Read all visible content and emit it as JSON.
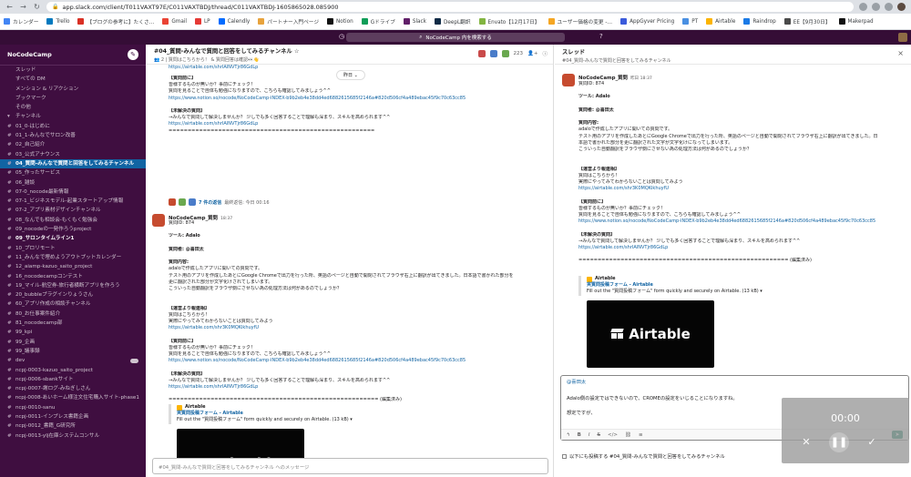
{
  "browser": {
    "url": "app.slack.com/client/T011VAXT97E/C011VAXTBDJ/thread/C011VAXTBDJ-1605865028.085900",
    "bookmarks": [
      {
        "label": "カレンダー",
        "color": "#4285f4"
      },
      {
        "label": "Trello",
        "color": "#0079bf"
      },
      {
        "label": "【ブログの参考に】たくさ…",
        "color": "#d93025"
      },
      {
        "label": "Gmail",
        "color": "#ea4335"
      },
      {
        "label": "LP",
        "color": "#e53935"
      },
      {
        "label": "Calendly",
        "color": "#006bff"
      },
      {
        "label": "パートナー入門ページ",
        "color": "#e8a33d"
      },
      {
        "label": "Notion",
        "color": "#111111"
      },
      {
        "label": "Gドライブ",
        "color": "#0f9d58"
      },
      {
        "label": "Slack",
        "color": "#611f69"
      },
      {
        "label": "DeepL翻訳",
        "color": "#0f2b46"
      },
      {
        "label": "Envato【12月17日】",
        "color": "#82b541"
      },
      {
        "label": "ユーザー価格の変更 -…",
        "color": "#f5a623"
      },
      {
        "label": "AppGyver Pricing",
        "color": "#3b5bdb"
      },
      {
        "label": "PT",
        "color": "#4a90e2"
      },
      {
        "label": "Airtable",
        "color": "#fcb400"
      },
      {
        "label": "Raindrop",
        "color": "#1a7ae6"
      },
      {
        "label": "EE【9月30日】",
        "color": "#4a4a4a"
      },
      {
        "label": "Makerpad",
        "color": "#111111"
      }
    ]
  },
  "slack_top": {
    "search_text": "NoCodeCamp 内を検索する"
  },
  "sidebar": {
    "workspace": "NoCodeCamp",
    "items": [
      {
        "label": "スレッド",
        "icon": "",
        "style": ""
      },
      {
        "label": "すべての DM",
        "icon": "",
        "style": ""
      },
      {
        "label": "メンション & リアクション",
        "icon": "",
        "style": ""
      },
      {
        "label": "ブックマーク",
        "icon": "",
        "style": ""
      },
      {
        "label": "その他",
        "icon": "",
        "style": ""
      },
      {
        "label": "チャンネル",
        "icon": "▾",
        "style": ""
      },
      {
        "label": "01_0-はじめに",
        "icon": "#",
        "style": ""
      },
      {
        "label": "01_1-みんなでサロン改善",
        "icon": "#",
        "style": ""
      },
      {
        "label": "02_自己紹介",
        "icon": "#",
        "style": ""
      },
      {
        "label": "03_公式アナウンス",
        "icon": "#",
        "style": ""
      },
      {
        "label": "04_質問-みんなで質問と回答をしてみるチャンネル",
        "icon": "#",
        "style": "active"
      },
      {
        "label": "05_作ったサービス",
        "icon": "#",
        "style": ""
      },
      {
        "label": "06_雑談",
        "icon": "#",
        "style": ""
      },
      {
        "label": "07-0_nocode最新情報",
        "icon": "#",
        "style": ""
      },
      {
        "label": "07-1_ビジネスモデル-起業スタートアップ情報",
        "icon": "#",
        "style": ""
      },
      {
        "label": "07-2_アプリ素材デザインチャンネル",
        "icon": "#",
        "style": ""
      },
      {
        "label": "08_なんでも相談会-もくもく勉強会",
        "icon": "#",
        "style": ""
      },
      {
        "label": "09_nocodeの一発作ろうproject",
        "icon": "#",
        "style": ""
      },
      {
        "label": "09_サロンタイムライン1",
        "icon": "#",
        "style": "bold"
      },
      {
        "label": "10_プロリモート",
        "icon": "#",
        "style": ""
      },
      {
        "label": "11_みんなで埋めようアウトプットカレンダー",
        "icon": "#",
        "style": ""
      },
      {
        "label": "12_aiamp-kazuo_saito_project",
        "icon": "#",
        "style": ""
      },
      {
        "label": "16_nocodecampコンテスト",
        "icon": "#",
        "style": ""
      },
      {
        "label": "19_マイル-航空券-旅行者横断アプリを作ろう",
        "icon": "#",
        "style": ""
      },
      {
        "label": "20_bubbleプラグインりょうさん",
        "icon": "#",
        "style": ""
      },
      {
        "label": "60_アプリ作成の相談チャンネル",
        "icon": "#",
        "style": ""
      },
      {
        "label": "80_お仕事案件紹介",
        "icon": "#",
        "style": ""
      },
      {
        "label": "81_nocodecamp部",
        "icon": "#",
        "style": ""
      },
      {
        "label": "99_kpi",
        "icon": "#",
        "style": ""
      },
      {
        "label": "99_企画",
        "icon": "#",
        "style": ""
      },
      {
        "label": "99_議事録",
        "icon": "#",
        "style": ""
      },
      {
        "label": "dev",
        "icon": "#",
        "style": "toggle"
      },
      {
        "label": "ncpj-0003-kazuo_saito_project",
        "icon": "#",
        "style": ""
      },
      {
        "label": "ncpj-0006-sbankサイト",
        "icon": "#",
        "style": ""
      },
      {
        "label": "ncpj-0007-謝ログ-みねぎしさん",
        "icon": "#",
        "style": ""
      },
      {
        "label": "ncpj-0008-あいホーム様注文住宅購入サイト-phase1",
        "icon": "#",
        "style": ""
      },
      {
        "label": "ncpj-0010-sanu",
        "icon": "#",
        "style": ""
      },
      {
        "label": "ncpj-0011-インプレス書籍企画",
        "icon": "#",
        "style": ""
      },
      {
        "label": "ncpj-0012_書籍_G研究所",
        "icon": "#",
        "style": ""
      },
      {
        "label": "ncpj-0013-ylj在庫システムコンサル",
        "icon": "#",
        "style": ""
      }
    ]
  },
  "channel": {
    "title": "#04_質問-みんなで質問と回答をしてみるチャンネル ☆",
    "topic": "👥 2  |  質問はこちらから！ & 質問回答は確認👀👋",
    "member_count": "223",
    "day_label": "昨日 ⌄",
    "old_link": "https://airtable.com/shrIAINVTjr86GdLp",
    "q_block": [
      {
        "t": "【質問前に】",
        "c": "bold"
      },
      {
        "t": "皆様するものが無いか？事前にチェック！",
        "c": ""
      },
      {
        "t": "質問を見ることで自体も勉強になりますので、こちらも確認してみましょう^^",
        "c": ""
      },
      {
        "t": "https://www.notion.so/nocode/NoCodeCamp-INDEX-b9b2eb4e38dd4ed6882615685f2146a#820d506cf4a489ebac45f9c70c63cc85",
        "c": "lnk"
      },
      {
        "t": "",
        "c": ""
      },
      {
        "t": "【未解決の質問】",
        "c": "bold"
      },
      {
        "t": "→みんなで質問して解決しませんか？ 少しでも多く回答することで理解も深まり、スキルを高められます^^",
        "c": ""
      },
      {
        "t": "https://airtable.com/shrIAINVTjr86GdLp",
        "c": "lnk"
      },
      {
        "t": "======================================================",
        "c": ""
      }
    ],
    "reactions": {
      "count_text": "7 件の返信",
      "last_text": "最終返信: 今日 00:16"
    },
    "msg2": {
      "name": "NoCodeCamp_質問",
      "time": "18:37",
      "lines": [
        {
          "t": "質問ID: 874",
          "c": ""
        },
        {
          "t": "",
          "c": ""
        },
        {
          "t": "ツール: Adalo",
          "c": "bold"
        },
        {
          "t": "",
          "c": ""
        },
        {
          "t": "質問者: @喜田太",
          "c": "bold"
        },
        {
          "t": "",
          "c": ""
        },
        {
          "t": "質問内容:",
          "c": "bold"
        },
        {
          "t": "adaloで作成したアプリに開いての質問です。",
          "c": ""
        },
        {
          "t": "テスト用のアプリを作成したあとにGoogle Chromeで出力を行った所、英語のページと自動で開閉されてブラウザ右上に翻訳が出てきました。日本語で書かれた部分を",
          "c": ""
        },
        {
          "t": "更に翻訳された部分が文字化けされてしまいます。",
          "c": ""
        },
        {
          "t": "こういった自動翻訳をブラウザ側にさせない為の処理方法は何があるのでしょうか？",
          "c": ""
        },
        {
          "t": "",
          "c": ""
        },
        {
          "t": "",
          "c": ""
        },
        {
          "t": "【運営より報連相】",
          "c": "bold"
        },
        {
          "t": "質問はこちらから！",
          "c": ""
        },
        {
          "t": "実際にやってみてわからないことは質問してみよう",
          "c": ""
        },
        {
          "t": "https://airtable.com/shr3K0MQKikhuyfU",
          "c": "lnk"
        },
        {
          "t": "",
          "c": ""
        },
        {
          "t": "【質問前に】",
          "c": "bold"
        },
        {
          "t": "皆様するものが無いか？事前にチェック！",
          "c": ""
        },
        {
          "t": "質問を見ることで自体も勉強になりますので、こちらも確認してみましょう^^",
          "c": ""
        },
        {
          "t": "https://www.notion.so/nocode/NoCodeCamp-INDEX-b9b2eb4e38dd4ed6882615685f2146a#820d506cf4a489ebac45f9c70c63cc85",
          "c": "lnk"
        },
        {
          "t": "",
          "c": ""
        },
        {
          "t": "【未解決の質問】",
          "c": "bold"
        },
        {
          "t": "→みんなで質問して解決しませんか？ 少しでも多く回答することで理解も深まり、スキルを高められます^^",
          "c": ""
        },
        {
          "t": "https://airtable.com/shrIAINVTjr86GdLp",
          "c": "lnk"
        },
        {
          "t": "",
          "c": ""
        },
        {
          "t": "======================================================= (編集済み)",
          "c": ""
        }
      ]
    },
    "unfurl": {
      "source": "Airtable",
      "title": "実質問投稿フォーム - Airtable",
      "desc": "Fill out the \"質問投稿フォーム\" form quickly and securely on Airtable. (13 kB) ▾",
      "brand": "Airtable"
    },
    "composer_placeholder": "#04_質問-みんなで質問と回答をしてみるチャンネル へのメッセージ"
  },
  "thread": {
    "title": "スレッド",
    "sub": "#04_質問-みんなで質問と回答をしてみるチャンネル",
    "name": "NoCodeCamp_質問",
    "time": "昨日 18:37",
    "lines": [
      {
        "t": "質問ID: 874",
        "c": ""
      },
      {
        "t": "",
        "c": ""
      },
      {
        "t": "ツール: Adalo",
        "c": "bold"
      },
      {
        "t": "",
        "c": ""
      },
      {
        "t": "質問者: @喜田太",
        "c": "bold"
      },
      {
        "t": "",
        "c": ""
      },
      {
        "t": "質問内容:",
        "c": "bold"
      },
      {
        "t": "adaloで作成したアプリに開いての質問です。",
        "c": ""
      },
      {
        "t": "テスト用のアプリを作成したあとにGoogle Chromeで出力を行った所、英語のページと自動で開閉されてブラウザ右上に翻訳が出てきました。日",
        "c": ""
      },
      {
        "t": "本語で書かれた部分を更に翻訳された文字が文字化けになってしまいます。",
        "c": ""
      },
      {
        "t": "こういった自動翻訳をブラウザ側にさせない為の処理方法は何があるのでしょうか？",
        "c": ""
      },
      {
        "t": "",
        "c": ""
      },
      {
        "t": "",
        "c": ""
      },
      {
        "t": "【運営より報連相】",
        "c": "bold"
      },
      {
        "t": "質問はこちらから！",
        "c": ""
      },
      {
        "t": "実際にやってみてわからないことは質問してみよう",
        "c": ""
      },
      {
        "t": "https://airtable.com/shr3K0MQKikhuyfU",
        "c": "lnk"
      },
      {
        "t": "",
        "c": ""
      },
      {
        "t": "【質問前に】",
        "c": "bold"
      },
      {
        "t": "皆様するものが無いか？事前にチェック！",
        "c": ""
      },
      {
        "t": "質問を見ることで自体も勉強になりますので、こちらも確認してみましょう^^",
        "c": ""
      },
      {
        "t": "https://www.notion.so/nocode/NoCodeCamp-INDEX-b9b2eb4e38dd4ed6882615685f2146a#820d506cf4a489ebac45f9c70c63cc85",
        "c": "lnk"
      },
      {
        "t": "",
        "c": ""
      },
      {
        "t": "【未解決の質問】",
        "c": "bold"
      },
      {
        "t": "→みんなで質問して解決しませんか？ 少しでも多く回答することで理解も深まり、スキルを高められます^^",
        "c": ""
      },
      {
        "t": "https://airtable.com/shrIAINVTjr86GdLp",
        "c": "lnk"
      },
      {
        "t": "",
        "c": ""
      },
      {
        "t": "======================================================= (編集済み)",
        "c": ""
      }
    ],
    "reply": {
      "mention": "@喜田太",
      "line1": "Adalo側の設定ではできないので、CROMEの設定をいじることになりますね。",
      "line2": "想定ですが、"
    },
    "also_send": "以下にも投稿する #04_質問-みんなで質問と回答をしてみるチャンネル"
  },
  "recorder": {
    "time": "00:00"
  }
}
